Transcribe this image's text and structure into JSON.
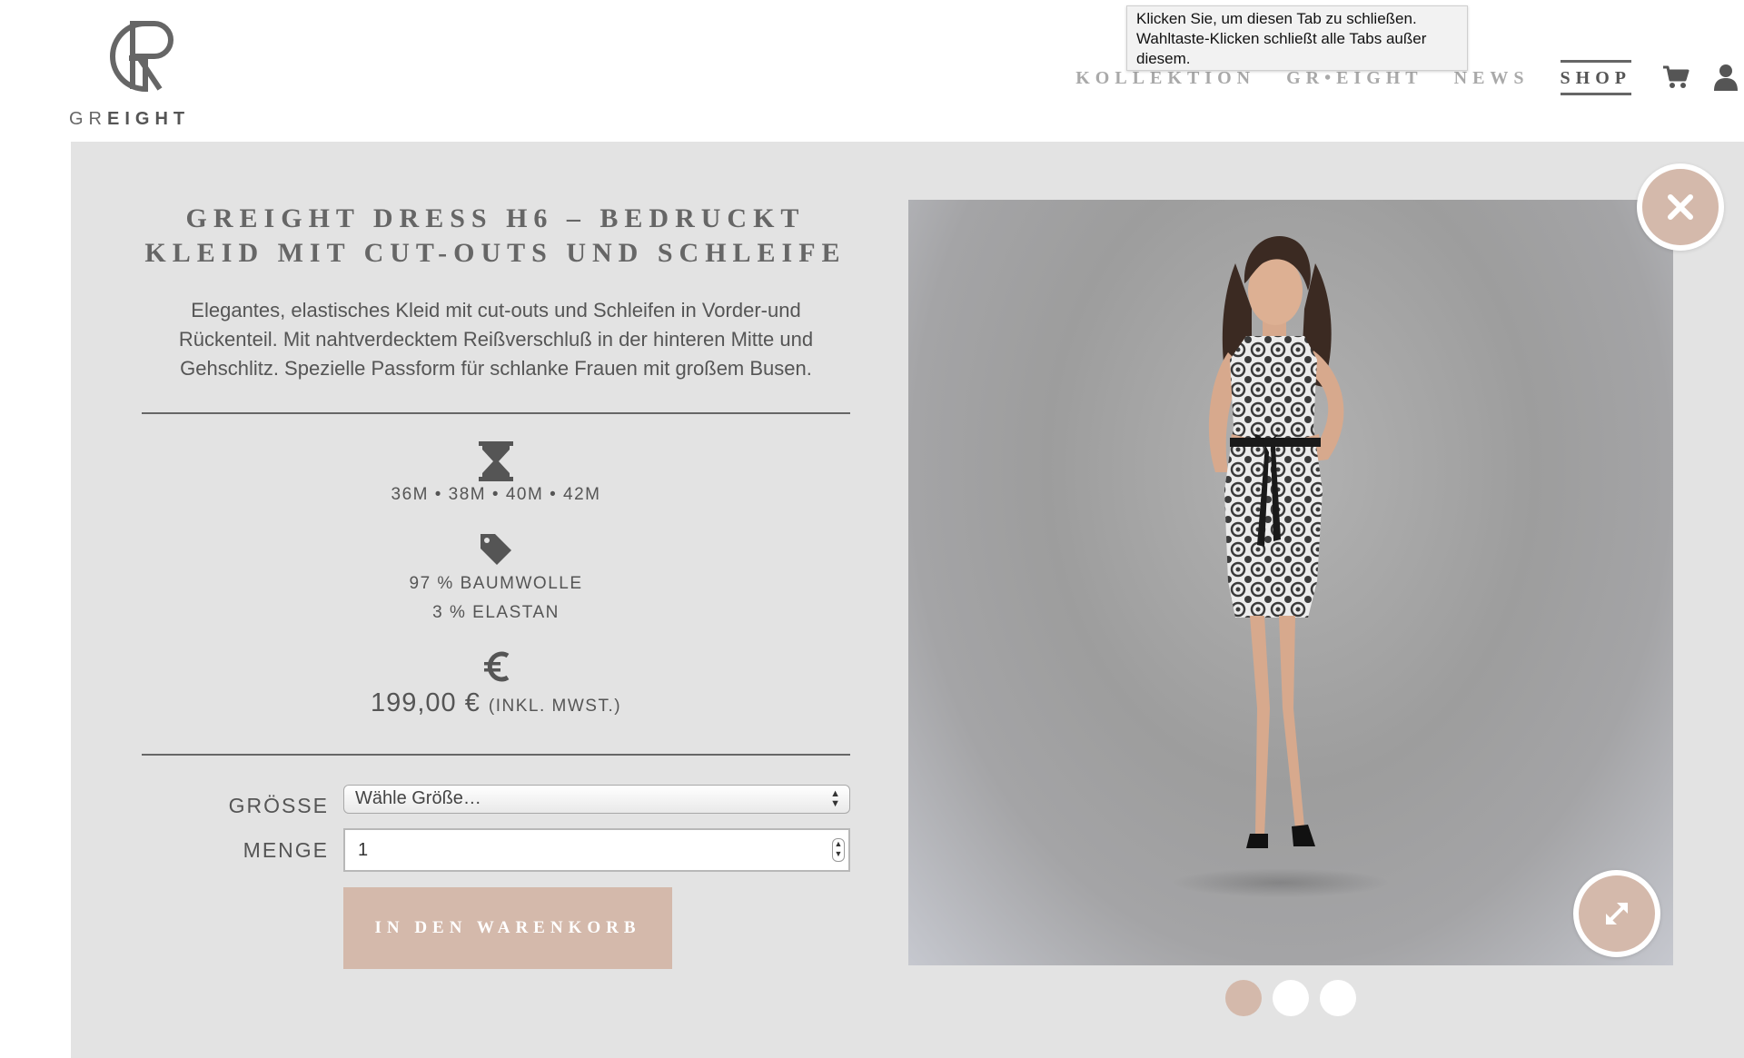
{
  "brand": {
    "logo_text_light": "GR",
    "logo_text_bold": "EIGHT"
  },
  "nav": {
    "items": [
      {
        "label": "KOLLEKTION"
      },
      {
        "label": "GR•EIGHT"
      },
      {
        "label": "NEWS"
      },
      {
        "label": "SHOP",
        "active": true
      }
    ],
    "cart_icon": "cart-icon",
    "user_icon": "user-icon"
  },
  "tooltip": {
    "line1": "Klicken Sie, um diesen Tab zu schließen.",
    "line2": "Wahltaste-Klicken schließt alle Tabs außer",
    "line3": "diesem."
  },
  "product": {
    "title_line1": "GREIGHT DRESS H6 – BEDRUCKT",
    "title_line2": "KLEID MIT CUT-OUTS UND SCHLEIFE",
    "description_line1": "Elegantes, elastisches Kleid mit cut-outs und Schleifen in Vorder-und",
    "description_line2": "Rückenteil. Mit nahtverdecktem Reißverschluß in der hinteren Mitte und",
    "description_line3": "Gehschlitz. Spezielle Passform für schlanke Frauen mit großem Busen.",
    "sizes": "36M • 38M • 40M • 42M",
    "material_line1": "97 % BAUMWOLLE",
    "material_line2": "3 % ELASTAN",
    "price": "199,00 €",
    "price_note": "(INKL. MWST.)",
    "icons": [
      "hourglass-icon",
      "tag-icon",
      "euro-icon"
    ]
  },
  "form": {
    "size_label": "GRÖSSE",
    "size_value": "Wähle Größe…",
    "qty_label": "MENGE",
    "qty_value": "1",
    "add_to_cart": "IN DEN WARENKORB"
  },
  "gallery": {
    "slide_count": 3,
    "active_slide": 1,
    "close_icon": "close-icon",
    "expand_icon": "expand-icon"
  },
  "colors": {
    "accent": "#d4b9ab",
    "panel_bg": "#e3e3e3",
    "text": "#555555",
    "nav_inactive": "#a9a9a9"
  }
}
